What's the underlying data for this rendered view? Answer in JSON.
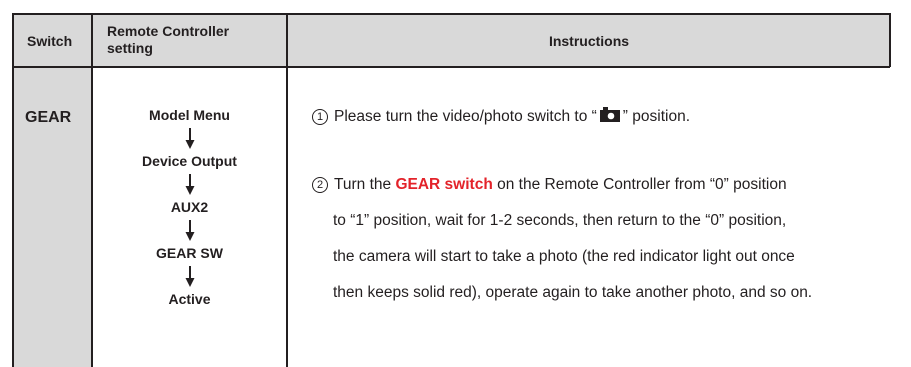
{
  "header": {
    "switch": "Switch",
    "remote_controller_setting": "Remote Controller setting",
    "instructions": "Instructions"
  },
  "row": {
    "switch_name": "GEAR",
    "flow": [
      "Model Menu",
      "Device Output",
      "AUX2",
      "GEAR SW",
      "Active"
    ],
    "step1": {
      "num": "1",
      "before": "Please turn the video/photo switch to “",
      "icon": "camera-icon",
      "after": "” position."
    },
    "step2": {
      "num": "2",
      "prefix": "Turn the ",
      "highlight": "GEAR switch",
      "line1_rest": " on the Remote Controller from “0” position",
      "line2": "to “1” position, wait for 1-2 seconds, then return to the “0” position,",
      "line3": "the camera will start to take a photo (the red indicator light out once",
      "line4": "then keeps solid red), operate again to take another photo, and so on."
    }
  },
  "colors": {
    "header_bg": "#d9d9d9",
    "highlight": "#e3232a",
    "text": "#231f20"
  }
}
